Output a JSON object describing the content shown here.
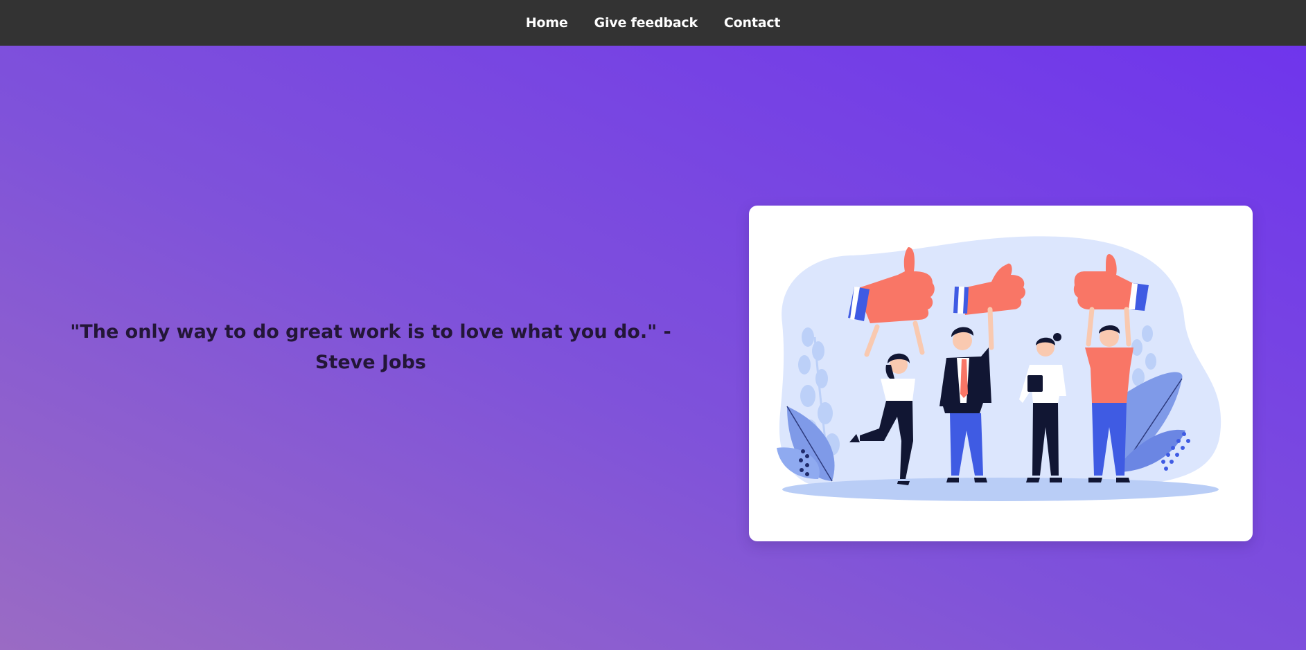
{
  "nav": {
    "items": [
      {
        "label": "Home"
      },
      {
        "label": "Give feedback"
      },
      {
        "label": "Contact"
      }
    ]
  },
  "hero": {
    "quote": "\"The only way to do great work is to love what you do.\" - Steve Jobs"
  },
  "illustration": {
    "icon": "thumbs-up-team-illustration"
  },
  "colors": {
    "navbar": "#333333",
    "gradient_start": "#9a6bc4",
    "gradient_end": "#6f35ec",
    "quote_text": "#231637",
    "thumb": "#f97666",
    "cuff": "#3f5be3",
    "blob": "#dce6fd"
  }
}
